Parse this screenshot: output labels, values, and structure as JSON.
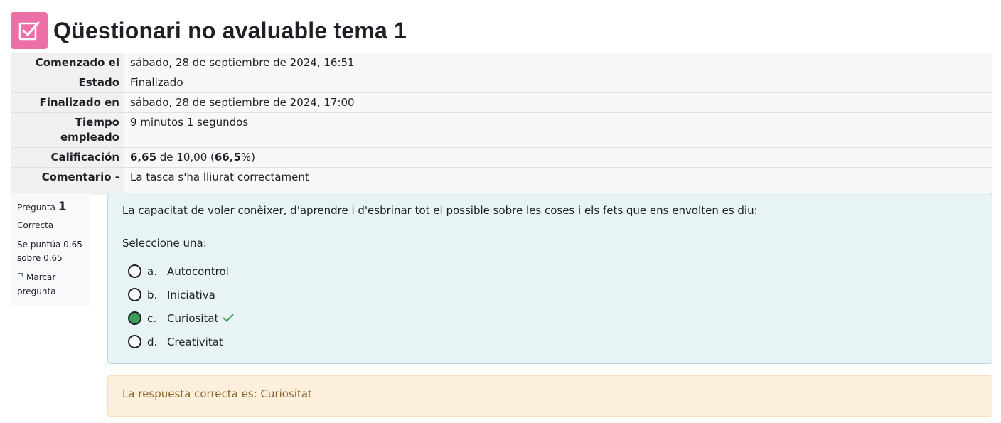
{
  "header": {
    "title": "Qüestionari no avaluable tema 1",
    "icon": "quiz-checkbox-icon",
    "icon_color": "#ec6fa8"
  },
  "summary": {
    "rows": [
      {
        "label": "Comenzado el",
        "value": "sábado, 28 de septiembre de 2024, 16:51"
      },
      {
        "label": "Estado",
        "value": "Finalizado"
      },
      {
        "label": "Finalizado en",
        "value": "sábado, 28 de septiembre de 2024, 17:00"
      },
      {
        "label": "Tiempo empleado",
        "value": "9 minutos 1 segundos"
      },
      {
        "label": "Calificación",
        "grade": "6,65",
        "grade_mid": " de 10,00 (",
        "percent": "66,5",
        "grade_end": "%)"
      },
      {
        "label": "Comentario -",
        "value": "La tasca s'ha lliurat correctament"
      }
    ]
  },
  "question": {
    "info": {
      "prefix": "Pregunta ",
      "number": "1",
      "state": "Correcta",
      "grade": "Se puntúa 0,65 sobre 0,65",
      "flag_label": "Marcar pregunta"
    },
    "text": "La capacitat de voler conèixer, d'aprendre i d'esbrinar tot el possible sobre les coses i els fets que ens envolten es diu:",
    "prompt": "Seleccione una:",
    "answers": [
      {
        "letter": "a.",
        "text": "Autocontrol",
        "selected": false
      },
      {
        "letter": "b.",
        "text": "Iniciativa",
        "selected": false
      },
      {
        "letter": "c.",
        "text": "Curiositat",
        "selected": true,
        "correct": true
      },
      {
        "letter": "d.",
        "text": "Creativitat",
        "selected": false
      }
    ],
    "feedback": "La respuesta correcta es: Curiositat"
  },
  "colors": {
    "correct": "#3c9c5a",
    "info_bg": "#e7f3f5",
    "feedback_bg": "#fcefdc",
    "feedback_text": "#8e662e"
  }
}
